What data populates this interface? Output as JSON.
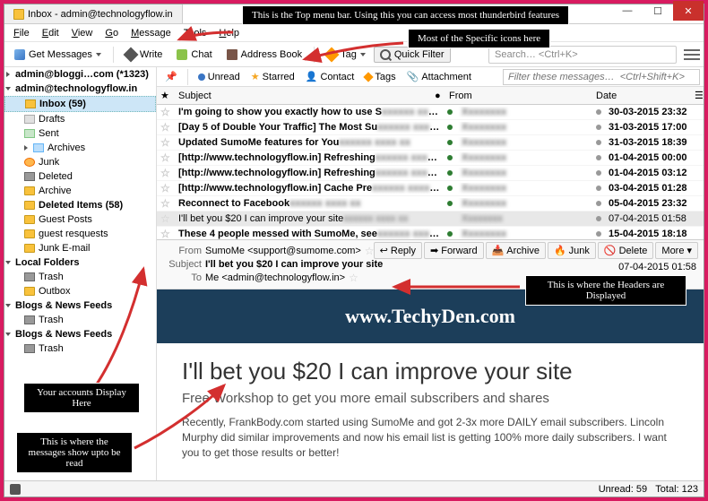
{
  "window": {
    "title": "Inbox - admin@technologyflow.in"
  },
  "menubar": [
    "File",
    "Edit",
    "View",
    "Go",
    "Message",
    "Tools",
    "Help"
  ],
  "toolbar": {
    "get": "Get Messages",
    "write": "Write",
    "chat": "Chat",
    "addr": "Address Book",
    "tag": "Tag",
    "filter": "Quick Filter",
    "search_ph": "Search…  <Ctrl+K>"
  },
  "sidebar": {
    "acct1": "admin@bloggi…com (*1323)",
    "acct2": "admin@technologyflow.in",
    "folders": [
      {
        "label": "Inbox (59)",
        "ico": "fi-inbox",
        "sel": true,
        "bold": true
      },
      {
        "label": "Drafts",
        "ico": "fi-drafts"
      },
      {
        "label": "Sent",
        "ico": "fi-sent"
      },
      {
        "label": "Archives",
        "ico": "fi-arch",
        "tw": true
      },
      {
        "label": "Junk",
        "ico": "fi-junk"
      },
      {
        "label": "Deleted",
        "ico": "fi-trash"
      },
      {
        "label": "Archive",
        "ico": "fi-folder"
      },
      {
        "label": "Deleted Items (58)",
        "ico": "fi-folder",
        "bold": true
      },
      {
        "label": "Guest Posts",
        "ico": "fi-folder"
      },
      {
        "label": "guest resquests",
        "ico": "fi-folder"
      },
      {
        "label": "Junk E-mail",
        "ico": "fi-folder"
      }
    ],
    "local": "Local Folders",
    "local_items": [
      {
        "label": "Trash",
        "ico": "fi-trash"
      },
      {
        "label": "Outbox",
        "ico": "fi-folder"
      }
    ],
    "feed1": "Blogs & News Feeds",
    "feed1_items": [
      {
        "label": "Trash",
        "ico": "fi-trash"
      }
    ],
    "feed2": "Blogs & News Feeds",
    "feed2_items": [
      {
        "label": "Trash",
        "ico": "fi-trash"
      }
    ]
  },
  "filterbar": {
    "unread": "Unread",
    "starred": "Starred",
    "contact": "Contact",
    "tags": "Tags",
    "attach": "Attachment",
    "ph": "Filter these messages…  <Ctrl+Shift+K>"
  },
  "cols": {
    "subject": "Subject",
    "from": "From",
    "date": "Date"
  },
  "messages": [
    {
      "s": "I'm going to show you exactly how to use S",
      "f": "",
      "d": "30-03-2015 23:32",
      "b": true
    },
    {
      "s": "[Day 5 of Double Your Traffic] The Most Su",
      "f": "",
      "d": "31-03-2015 17:00",
      "b": true
    },
    {
      "s": "Updated SumoMe features for You",
      "f": "",
      "d": "31-03-2015 18:39",
      "b": true
    },
    {
      "s": "[http://www.technologyflow.in] Refreshing",
      "f": "",
      "d": "01-04-2015 00:00",
      "b": true
    },
    {
      "s": "[http://www.technologyflow.in] Refreshing",
      "f": "",
      "d": "01-04-2015 03:12",
      "b": true
    },
    {
      "s": "[http://www.technologyflow.in] Cache Pre",
      "f": "",
      "d": "03-04-2015 01:28",
      "b": true
    },
    {
      "s": "Reconnect to Facebook",
      "f": "",
      "d": "05-04-2015 23:32",
      "b": true
    },
    {
      "s": "I'll bet you $20 I can improve your site",
      "f": "",
      "d": "07-04-2015 01:58",
      "b": false,
      "sel": true
    },
    {
      "s": "These 4 people messed with SumoMe, see",
      "f": "",
      "d": "15-04-2015 18:18",
      "b": true
    }
  ],
  "msg": {
    "from_lbl": "From",
    "from": "SumoMe <support@sumome.com>",
    "subj_lbl": "Subject",
    "subj": "I'll bet you $20 I can improve your site",
    "to_lbl": "To",
    "to": "Me <admin@technologyflow.in>",
    "date": "07-04-2015 01:58",
    "actions": {
      "reply": "Reply",
      "forward": "Forward",
      "archive": "Archive",
      "junk": "Junk",
      "delete": "Delete",
      "more": "More"
    },
    "wm": "www.TechyDen.com",
    "h1": "I'll bet you $20 I can improve your site",
    "h2": "Free Workshop to get you more email subscribers and shares",
    "p": "Recently, FrankBody.com started using SumoMe and got 2-3x more DAILY email subscribers. Lincoln Murphy did similar improvements and now his email list is getting 100% more daily subscribers. I want you to get those results or better!"
  },
  "status": {
    "unread": "Unread: 59",
    "total": "Total: 123"
  },
  "annos": {
    "top": "This is the Top menu bar. Using this you can access most thunderbird features",
    "icons": "Most of the Specific icons here",
    "accts": "Your accounts Display Here",
    "msgs": "This is where the messages show upto be read",
    "hdr": "This is where the Headers are Displayed"
  }
}
